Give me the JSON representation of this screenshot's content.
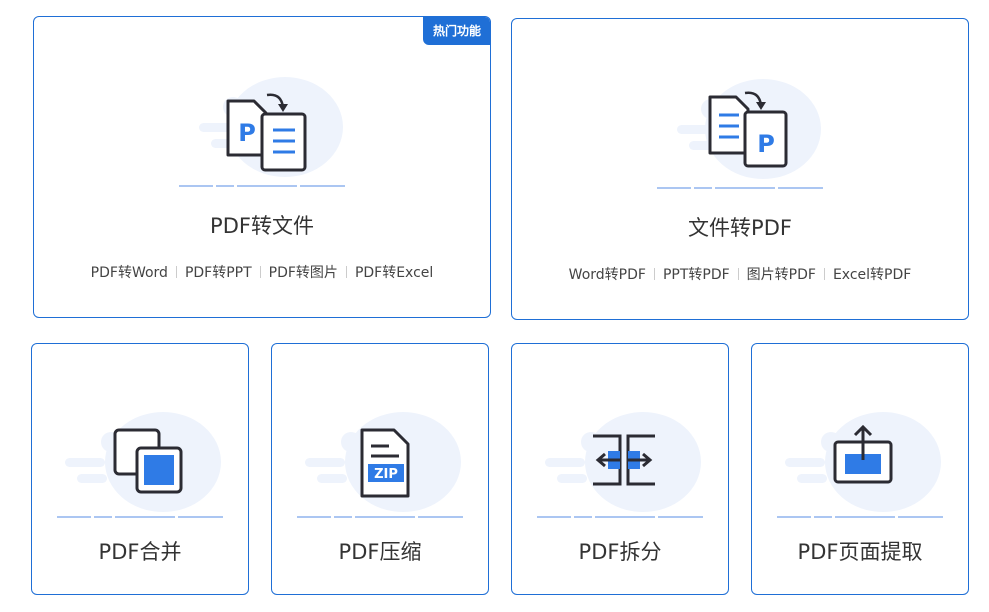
{
  "features": {
    "pdf_to_file": {
      "badge": "热门功能",
      "title": "PDF转文件",
      "links": [
        "PDF转Word",
        "PDF转PPT",
        "PDF转图片",
        "PDF转Excel"
      ]
    },
    "file_to_pdf": {
      "title": "文件转PDF",
      "links": [
        "Word转PDF",
        "PPT转PDF",
        "图片转PDF",
        "Excel转PDF"
      ]
    },
    "merge": {
      "title": "PDF合并"
    },
    "compress": {
      "title": "PDF压缩",
      "icon_label": "ZIP"
    },
    "split": {
      "title": "PDF拆分"
    },
    "extract": {
      "title": "PDF页面提取"
    }
  },
  "icons": {
    "pdf_to_file": "pdf-to-file-icon",
    "file_to_pdf": "file-to-pdf-icon",
    "merge": "merge-icon",
    "compress": "zip-file-icon",
    "split": "split-icon",
    "extract": "page-extract-icon"
  },
  "colors": {
    "accent": "#1f6fd6",
    "icon_blue": "#2f7be6",
    "icon_stroke": "#2b2b33",
    "selected_border": "#e04646",
    "bg_blob": "#eef3fc"
  }
}
